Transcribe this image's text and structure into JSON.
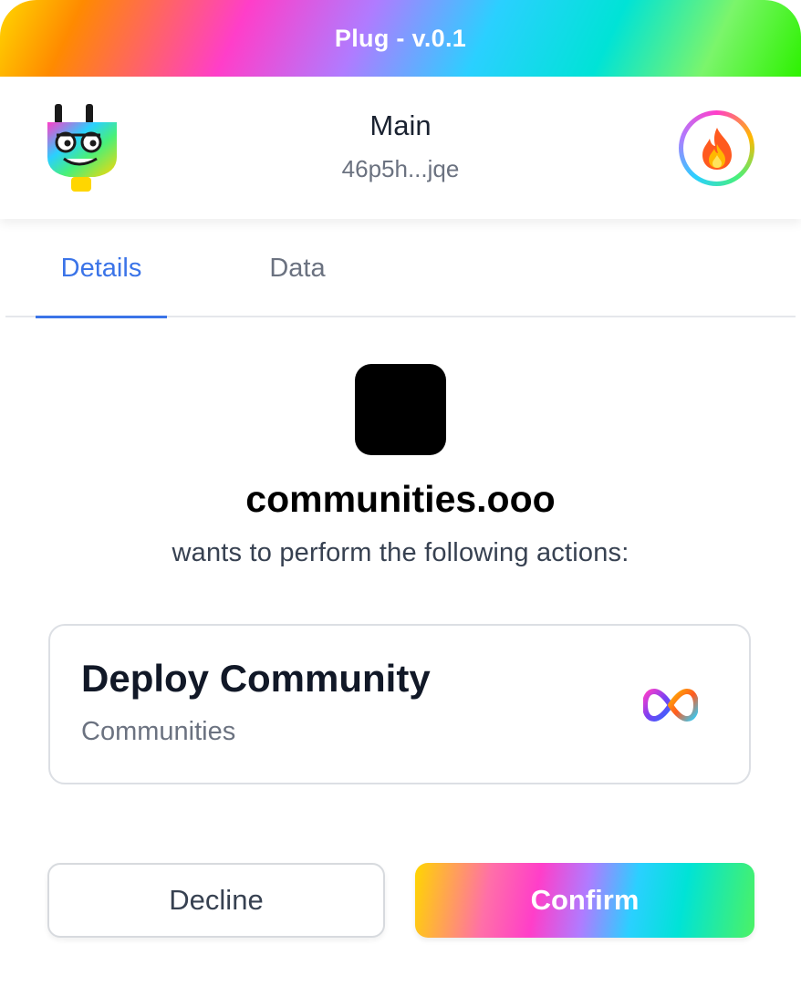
{
  "window": {
    "title": "Plug - v.0.1"
  },
  "header": {
    "account_name": "Main",
    "account_address": "46p5h...jqe",
    "logo_icon": "plug-logo-icon",
    "avatar_icon": "fire-emoji-icon"
  },
  "tabs": [
    {
      "label": "Details",
      "active": true
    },
    {
      "label": "Data",
      "active": false
    }
  ],
  "request": {
    "site_icon": "site-icon",
    "site_name": "communities.ooo",
    "description": "wants to perform the following actions:"
  },
  "action": {
    "title": "Deploy Community",
    "subtitle": "Communities",
    "icon": "infinity-icon"
  },
  "buttons": {
    "decline_label": "Decline",
    "confirm_label": "Confirm"
  },
  "colors": {
    "accent": "#3b74e8",
    "text_primary": "#111827",
    "text_secondary": "#6b7280"
  }
}
